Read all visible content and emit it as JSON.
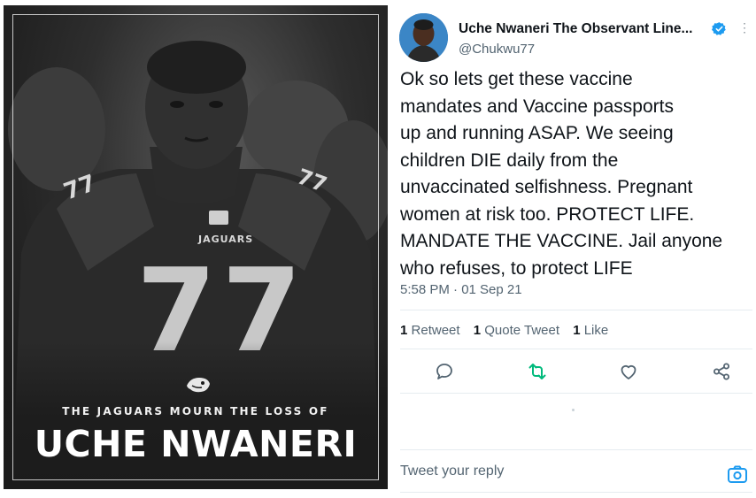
{
  "poster": {
    "subtitle": "THE JAGUARS MOURN THE LOSS OF",
    "title": "UCHE NWANERI",
    "jersey_number": "77",
    "jersey_wordmark": "JAGUARS",
    "logo_icon": "jaguars-logo-icon"
  },
  "tweet": {
    "display_name": "Uche Nwaneri The Observant Line...",
    "handle": "@Chukwu77",
    "verified_icon": "verified-badge-icon",
    "more_icon": "more-icon",
    "lines": [
      "Ok so lets get these vaccine",
      "mandates and Vaccine passports",
      "up and running ASAP. We seeing",
      "children DIE daily from the",
      "unvaccinated selfishness. Pregnant",
      "women at risk too. PROTECT LIFE.",
      "MANDATE THE VACCINE. Jail anyone",
      "who refuses, to protect LIFE"
    ],
    "timestamp": "5:58 PM · 01 Sep 21",
    "stats": {
      "retweets_count": "1",
      "retweets_label": "Retweet",
      "quotes_count": "1",
      "quotes_label": "Quote Tweet",
      "likes_count": "1",
      "likes_label": "Like"
    },
    "actions": [
      "reply-icon",
      "retweet-icon",
      "like-icon",
      "share-icon"
    ],
    "reply_placeholder": "Tweet your reply",
    "camera_icon": "camera-icon"
  },
  "colors": {
    "text": "#0f1419",
    "secondary": "#536471",
    "verified": "#1d9bf0",
    "retweet_green": "#00ba7c",
    "divider": "#e6ecf0"
  }
}
